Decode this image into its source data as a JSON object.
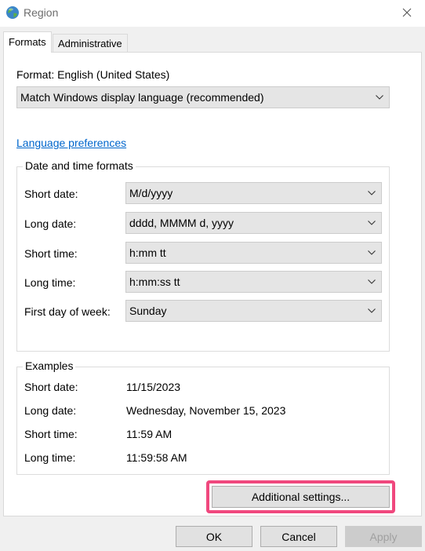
{
  "window": {
    "title": "Region",
    "close_icon": "close-icon",
    "app_icon": "globe-icon"
  },
  "tabs": [
    {
      "label": "Formats",
      "active": true
    },
    {
      "label": "Administrative",
      "active": false
    }
  ],
  "format": {
    "label": "Format: English (United States)",
    "selected": "Match Windows display language (recommended)"
  },
  "language_preferences_link": "Language preferences",
  "date_time_formats": {
    "title": "Date and time formats",
    "rows": [
      {
        "label": "Short date:",
        "value": "M/d/yyyy"
      },
      {
        "label": "Long date:",
        "value": "dddd, MMMM d, yyyy"
      },
      {
        "label": "Short time:",
        "value": "h:mm tt"
      },
      {
        "label": "Long time:",
        "value": "h:mm:ss tt"
      },
      {
        "label": "First day of week:",
        "value": "Sunday"
      }
    ]
  },
  "examples": {
    "title": "Examples",
    "rows": [
      {
        "label": "Short date:",
        "value": "11/15/2023"
      },
      {
        "label": "Long date:",
        "value": "Wednesday, November 15, 2023"
      },
      {
        "label": "Short time:",
        "value": "11:59 AM"
      },
      {
        "label": "Long time:",
        "value": "11:59:58 AM"
      }
    ]
  },
  "buttons": {
    "additional_settings": "Additional settings...",
    "ok": "OK",
    "cancel": "Cancel",
    "apply": "Apply",
    "apply_enabled": false
  },
  "colors": {
    "highlight": "#f0487e",
    "link": "#0066cc",
    "disabled_text": "#a0a0a0"
  }
}
